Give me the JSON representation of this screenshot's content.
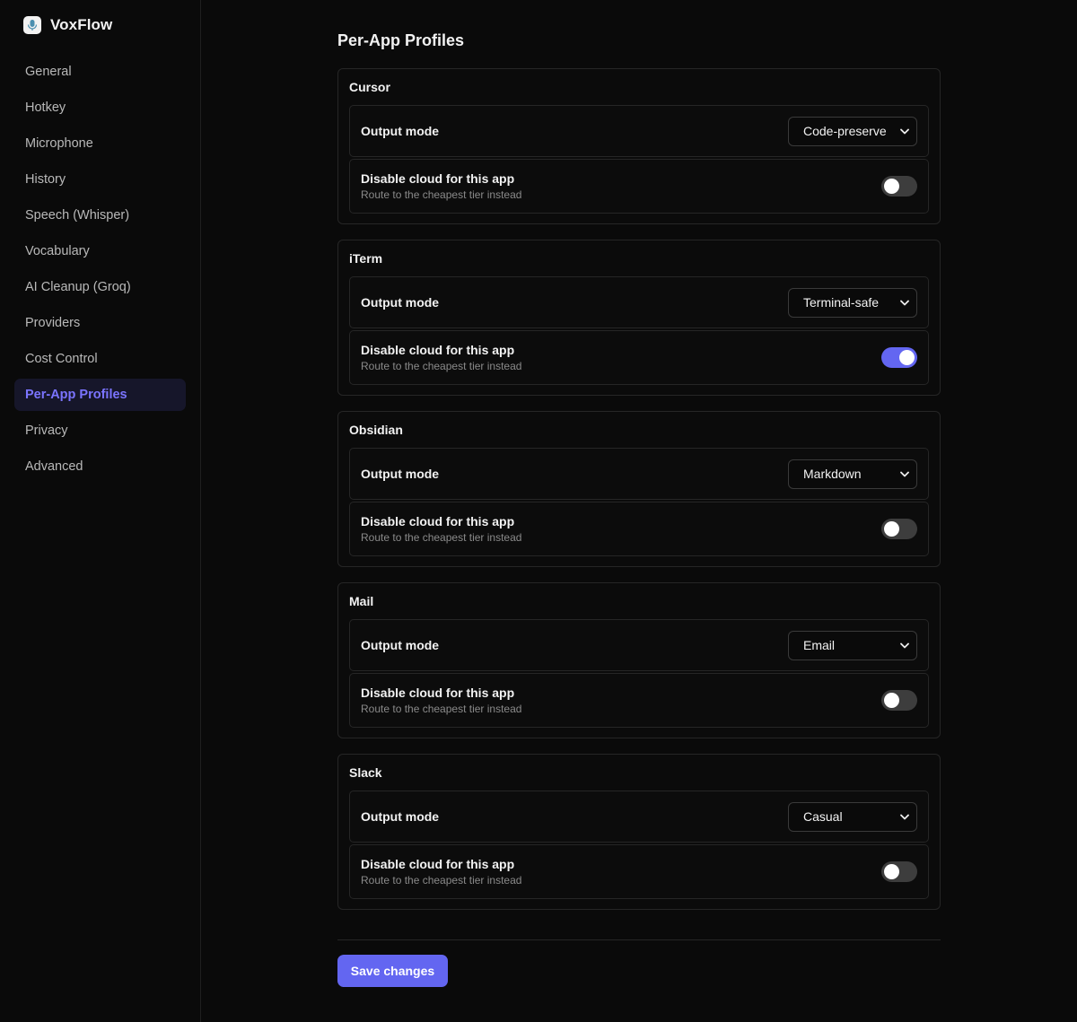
{
  "app": {
    "name": "VoxFlow"
  },
  "sidebar": {
    "items": [
      {
        "label": "General"
      },
      {
        "label": "Hotkey"
      },
      {
        "label": "Microphone"
      },
      {
        "label": "History"
      },
      {
        "label": "Speech (Whisper)"
      },
      {
        "label": "Vocabulary"
      },
      {
        "label": "AI Cleanup (Groq)"
      },
      {
        "label": "Providers"
      },
      {
        "label": "Cost Control"
      },
      {
        "label": "Per-App Profiles"
      },
      {
        "label": "Privacy"
      },
      {
        "label": "Advanced"
      }
    ],
    "active": "Per-App Profiles"
  },
  "page": {
    "title": "Per-App Profiles"
  },
  "labels": {
    "output_mode": "Output mode",
    "disable_cloud": "Disable cloud for this app",
    "disable_cloud_sub": "Route to the cheapest tier instead"
  },
  "profiles": [
    {
      "app": "Cursor",
      "output_mode": "Code-preserve",
      "disable_cloud": false
    },
    {
      "app": "iTerm",
      "output_mode": "Terminal-safe",
      "disable_cloud": true
    },
    {
      "app": "Obsidian",
      "output_mode": "Markdown",
      "disable_cloud": false
    },
    {
      "app": "Mail",
      "output_mode": "Email",
      "disable_cloud": false
    },
    {
      "app": "Slack",
      "output_mode": "Casual",
      "disable_cloud": false
    }
  ],
  "footer": {
    "save_label": "Save changes"
  },
  "colors": {
    "accent": "#6366f1",
    "active_nav_text": "#7b74ff",
    "background": "#0a0a0a"
  }
}
